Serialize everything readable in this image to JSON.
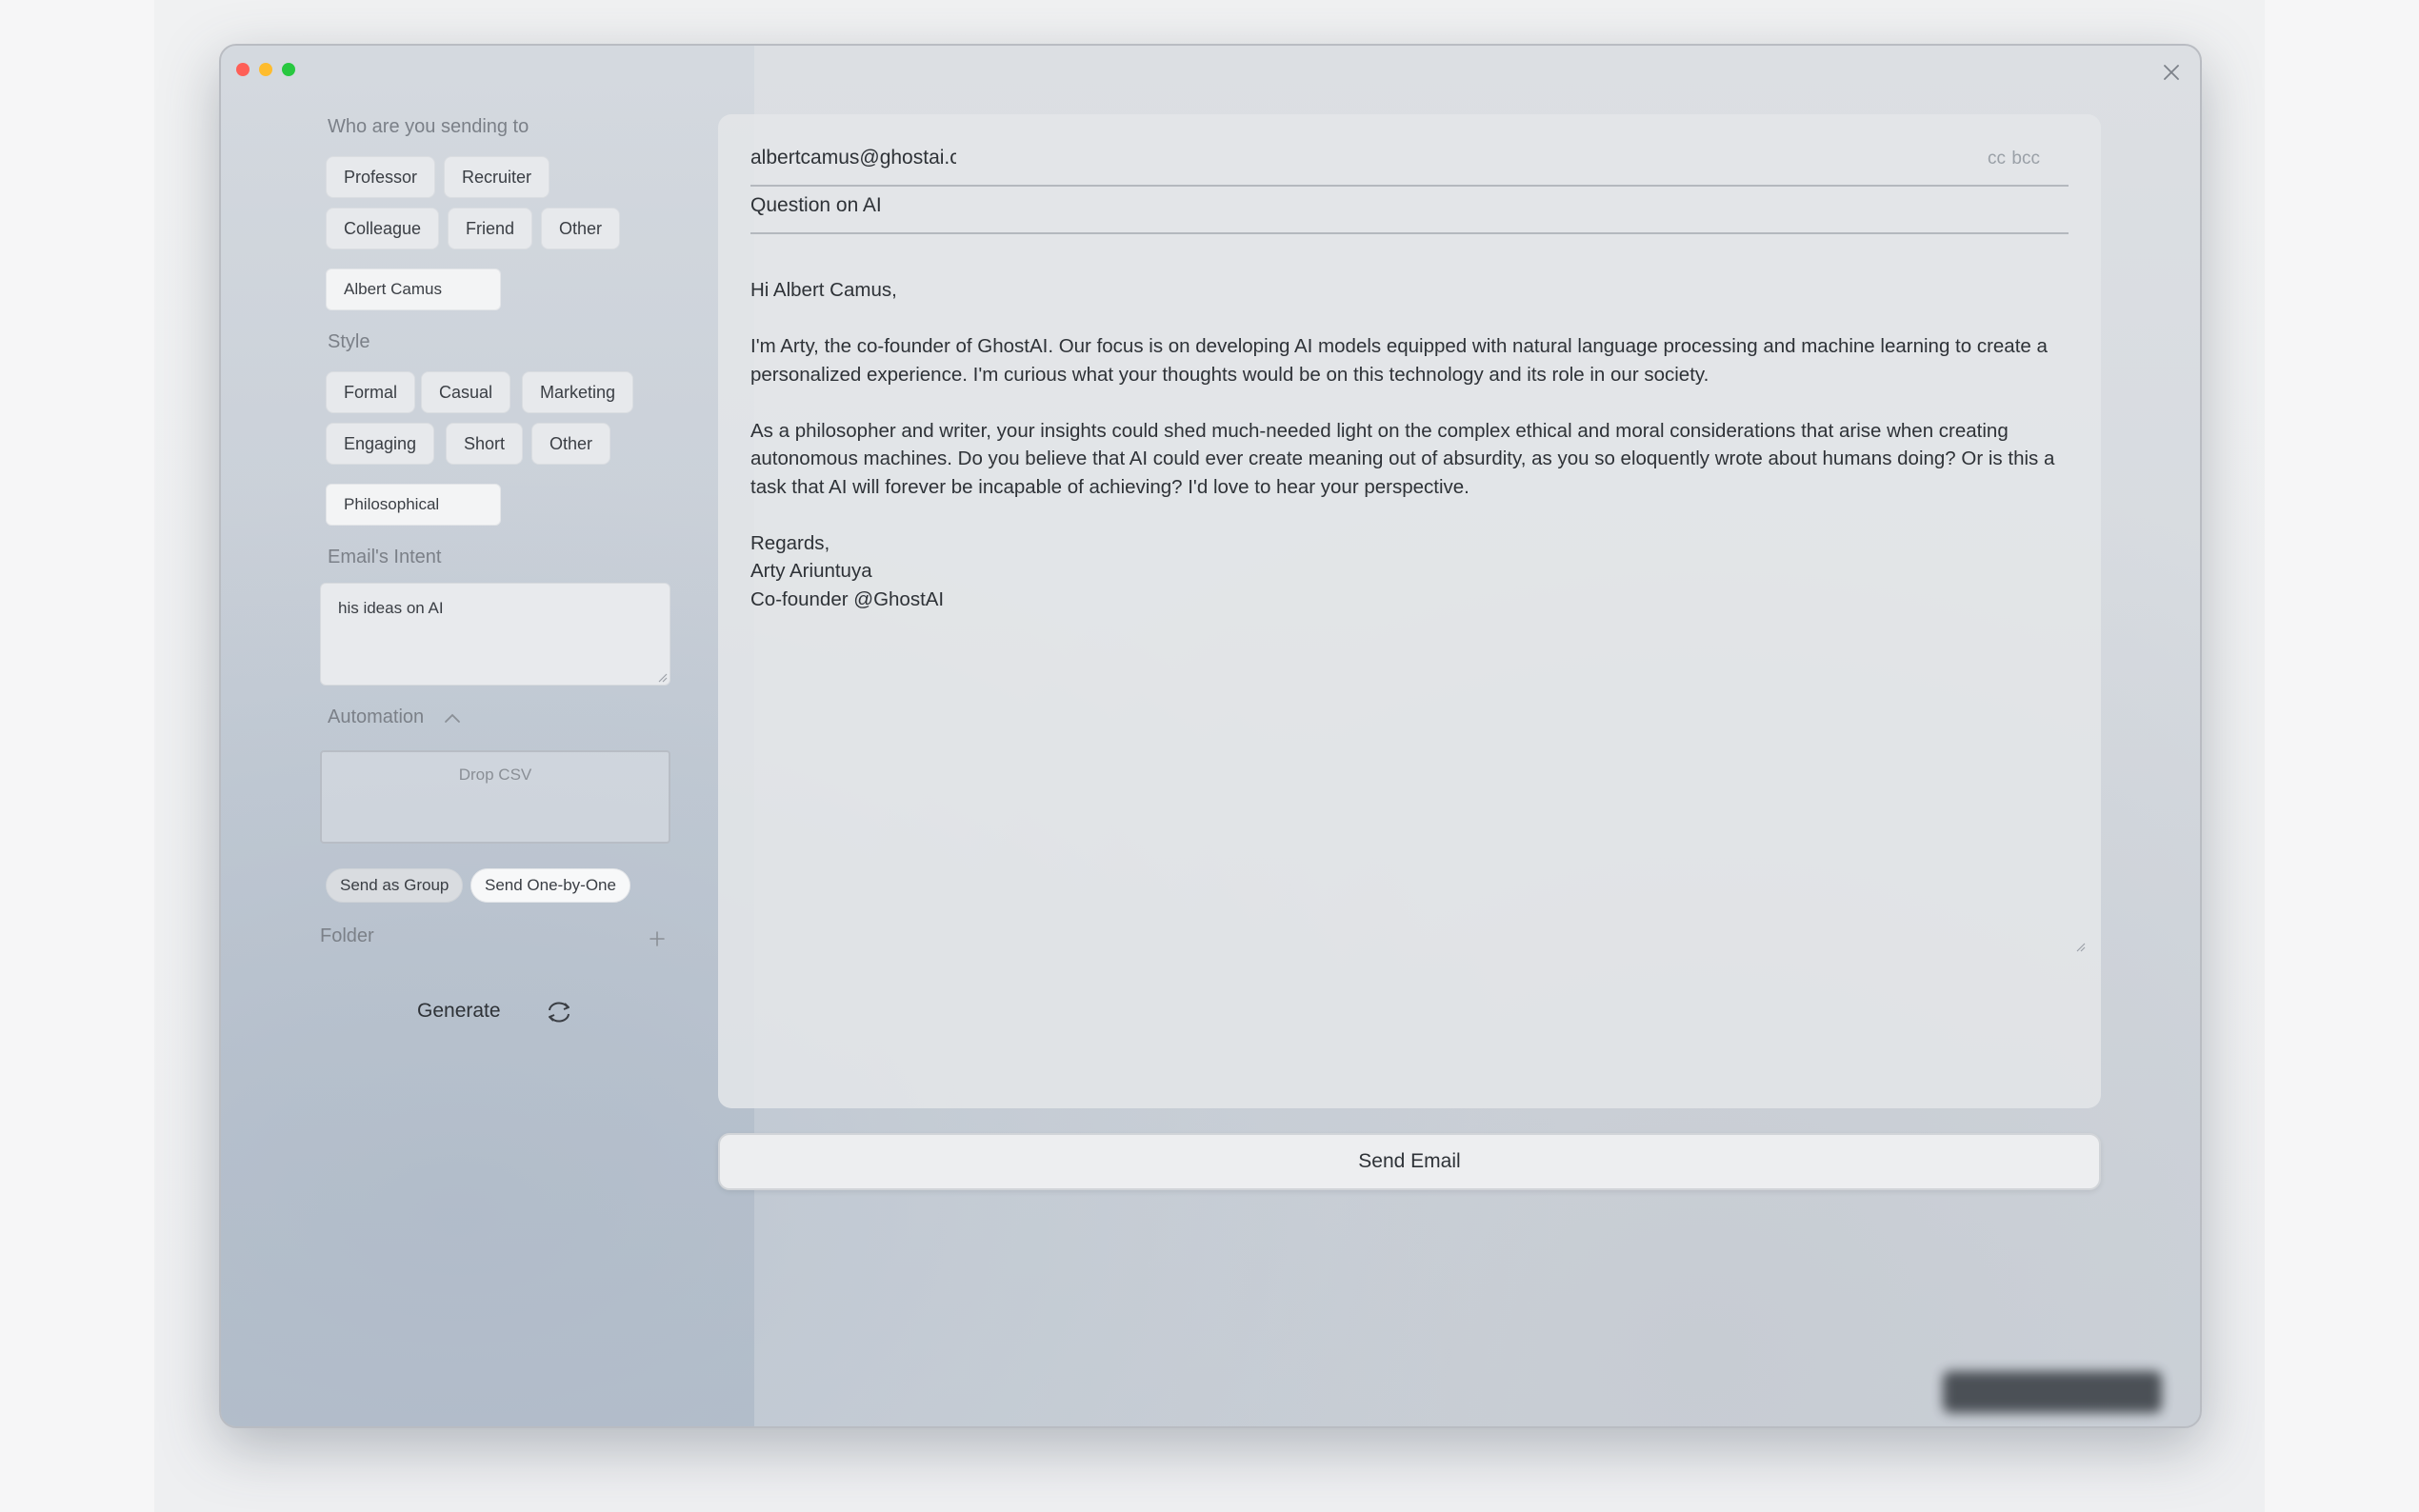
{
  "recipient": {
    "section_label": "Who are you sending to",
    "chips": [
      "Professor",
      "Recruiter",
      "Colleague",
      "Friend",
      "Other"
    ],
    "name_value": "Albert Camus"
  },
  "style": {
    "section_label": "Style",
    "chips": [
      "Formal",
      "Casual",
      "Marketing",
      "Engaging",
      "Short",
      "Other"
    ],
    "custom_value": "Philosophical"
  },
  "intent": {
    "section_label": "Email's Intent",
    "value": "his ideas on AI"
  },
  "automation": {
    "section_label": "Automation",
    "drop_label": "Drop CSV",
    "send_modes": [
      "Send as Group",
      "Send One-by-One"
    ],
    "selected_mode": "Send One-by-One"
  },
  "folder": {
    "label": "Folder"
  },
  "generate": {
    "label": "Generate"
  },
  "email": {
    "to": "albertcamus@ghostai.co",
    "cc_label": "cc",
    "bcc_label": "bcc",
    "subject": "Question on AI",
    "greeting": "Hi Albert Camus,",
    "paragraph_1": "I'm Arty, the co-founder of GhostAI. Our focus is on developing AI models equipped with natural language processing and machine learning to create a personalized experience. I'm curious what your thoughts would be on this technology and its role in our society.",
    "paragraph_2": "As a philosopher and writer, your insights could shed much-needed light on the complex ethical and moral considerations that arise when creating autonomous machines. Do you believe that AI could ever create meaning out of absurdity, as you so eloquently wrote about humans doing? Or is this a task that AI will forever be incapable of achieving? I'd love to hear your perspective.",
    "signoff": "Regards,",
    "signature_name": "Arty Ariuntuya",
    "signature_title": "Co-founder @GhostAI"
  },
  "send_button": {
    "label": "Send Email"
  },
  "colors": {
    "close_red": "#fe5f57",
    "minimize_yellow": "#febc2e",
    "maximize_green": "#28c840"
  }
}
